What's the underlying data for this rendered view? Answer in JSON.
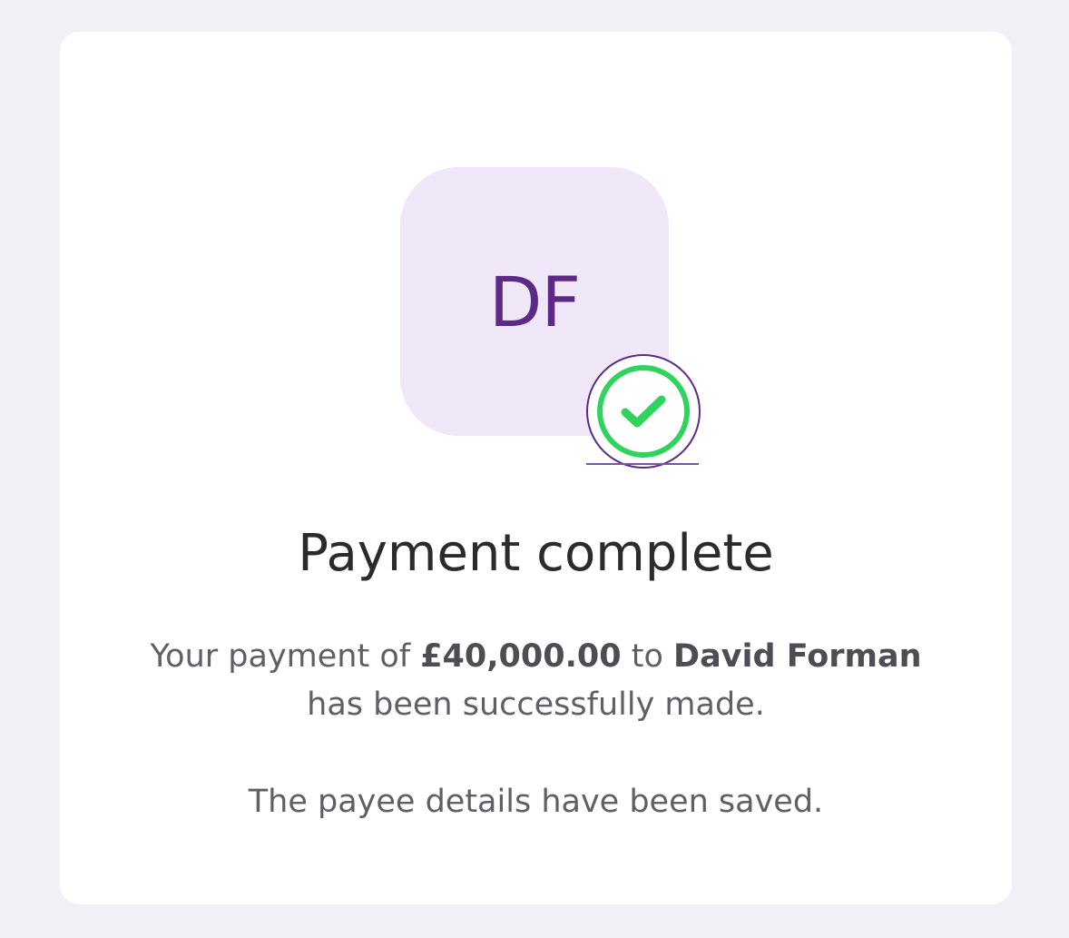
{
  "avatar": {
    "initials": "DF"
  },
  "status": {
    "icon": "check-circle-icon",
    "color": "#2fd35d"
  },
  "title": "Payment complete",
  "message": {
    "prefix": "Your payment of ",
    "amount": "£40,000.00",
    "middle": " to ",
    "payee_name": "David Forman",
    "suffix": "has been successfully made."
  },
  "note": "The payee details have been saved.",
  "colors": {
    "page_background": "#f1f0f7",
    "avatar_background": "#f0e8f9",
    "avatar_text": "#5b2a86",
    "success": "#2fd35d"
  }
}
